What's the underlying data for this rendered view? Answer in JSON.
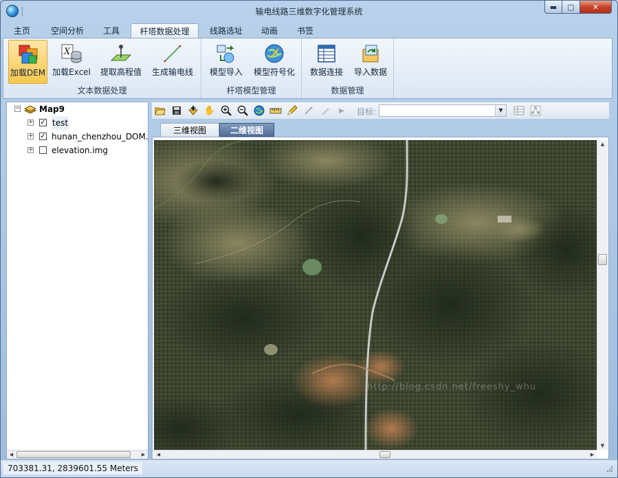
{
  "window": {
    "title": "输电线路三维数字化管理系统",
    "btn_min": "▬",
    "btn_max": "▢",
    "btn_close": "✕"
  },
  "menu": {
    "tabs": [
      {
        "label": "主页"
      },
      {
        "label": "空间分析"
      },
      {
        "label": "工具"
      },
      {
        "label": "杆塔数据处理",
        "active": true
      },
      {
        "label": "线路选址"
      },
      {
        "label": "动画"
      },
      {
        "label": "书签"
      }
    ]
  },
  "ribbon": {
    "groups": [
      {
        "label": "文本数据处理",
        "buttons": [
          "加载DEM",
          "加载Excel",
          "提取高程值",
          "生成输电线"
        ]
      },
      {
        "label": "杆塔模型管理",
        "buttons": [
          "模型导入",
          "模型符号化"
        ]
      },
      {
        "label": "数据管理",
        "buttons": [
          "数据连接",
          "导入数据"
        ]
      }
    ]
  },
  "toc": {
    "root": "Map9",
    "layers": [
      {
        "name": "test",
        "checked": true
      },
      {
        "name": "hunan_chenzhou_DOM.tif",
        "checked": true
      },
      {
        "name": "elevation.img",
        "checked": false
      }
    ]
  },
  "map_toolbar": {
    "target_label": "目标:",
    "target_value": ""
  },
  "view_tabs": [
    {
      "label": "三维视图"
    },
    {
      "label": "二维视图",
      "active": true
    }
  ],
  "watermark": "http://blog.csdn.net/freeshy_whu",
  "status": {
    "coords": "703381.31, 2839601.55  Meters"
  }
}
